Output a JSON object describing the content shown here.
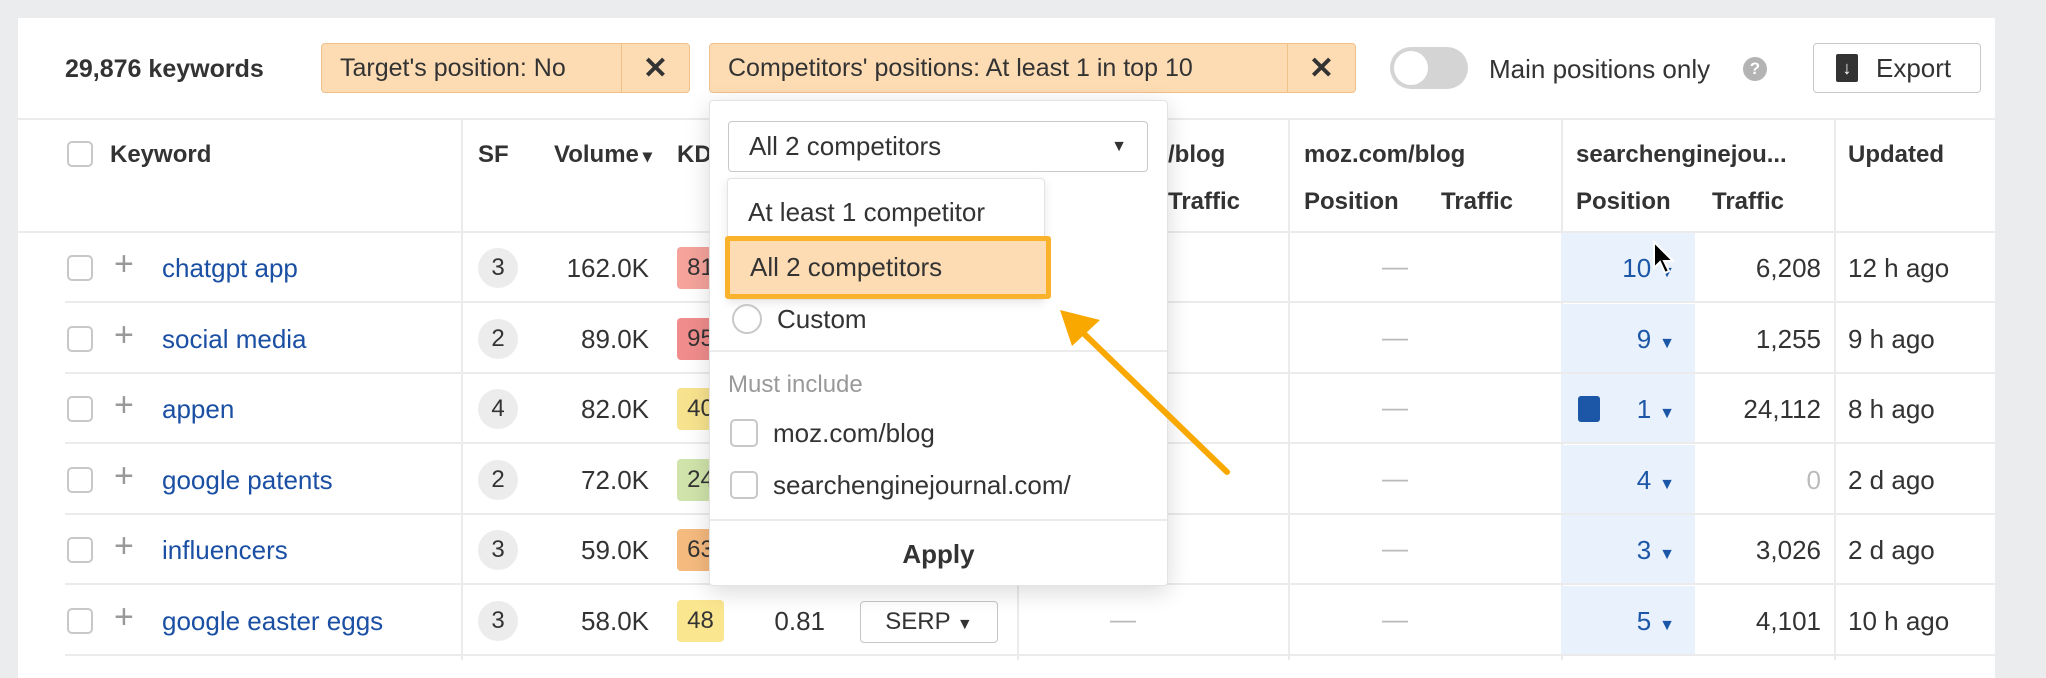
{
  "toolbar": {
    "count": "29,876 keywords",
    "filters": [
      {
        "label": "Target's position: No",
        "remove": "✕"
      },
      {
        "label": "Competitors' positions: At least 1 in top 10",
        "remove": "✕"
      }
    ],
    "toggle_label": "Main positions only",
    "toggle_on": false,
    "help": "?",
    "export_label": "Export"
  },
  "table": {
    "headers": {
      "keyword": "Keyword",
      "sf": "SF",
      "volume": "Volume",
      "sort": "▾",
      "kd": "KD",
      "comp1": "/blog",
      "comp1_traffic": "Traffic",
      "comp2": "moz.com/blog",
      "comp2_position": "Position",
      "comp2_traffic": "Traffic",
      "comp3": "searchenginejou...",
      "comp3_position": "Position",
      "comp3_traffic": "Traffic",
      "updated": "Updated"
    },
    "rows": [
      {
        "keyword": "chatgpt app",
        "sf": "3",
        "volume": "162.0K",
        "kd": "81",
        "kd_color": "#f5a39b",
        "moz": "—",
        "sej_position": "10",
        "sej_traffic": "6,208",
        "updated": "12 h ago"
      },
      {
        "keyword": "social media",
        "sf": "2",
        "volume": "89.0K",
        "kd": "95",
        "kd_color": "#f08c8c",
        "moz": "—",
        "sej_position": "9",
        "sej_traffic": "1,255",
        "updated": "9 h ago"
      },
      {
        "keyword": "appen",
        "sf": "4",
        "volume": "82.0K",
        "kd": "40",
        "kd_color": "#f7e38e",
        "moz": "—",
        "sej_position": "1",
        "sej_icon": "news-article-icon",
        "sej_traffic": "24,112",
        "updated": "8 h ago"
      },
      {
        "keyword": "google patents",
        "sf": "2",
        "volume": "72.0K",
        "kd": "24",
        "kd_color": "#cfe3aa",
        "moz": "—",
        "sej_position": "4",
        "sej_traffic": "0",
        "updated": "2 d ago"
      },
      {
        "keyword": "influencers",
        "sf": "3",
        "volume": "59.0K",
        "kd": "63",
        "kd_color": "#f5ba7e",
        "moz": "—",
        "sej_position": "3",
        "sej_traffic": "3,026",
        "updated": "2 d ago"
      },
      {
        "keyword": "google easter eggs",
        "sf": "3",
        "volume": "58.0K",
        "kd": "48",
        "kd_color": "#fbe690",
        "cpc": "0.81",
        "serp": "SERP",
        "comp1": "—",
        "moz": "—",
        "sej_position": "5",
        "sej_traffic": "4,101",
        "updated": "10 h ago"
      }
    ]
  },
  "dropdown": {
    "selected": "All 2 competitors",
    "options": [
      "At least 1 competitor",
      "All 2 competitors",
      "Custom"
    ],
    "highlighted": "All 2 competitors",
    "must_include_label": "Must include",
    "must_include": [
      "moz.com/blog",
      "searchenginejournal.com/"
    ],
    "apply": "Apply"
  },
  "colors": {
    "chip": "#fddcb4",
    "link": "#1a4fa3",
    "highlight_border": "#fbb22b",
    "arrow": "#f9a800",
    "position_column": "#e8f1fc"
  }
}
